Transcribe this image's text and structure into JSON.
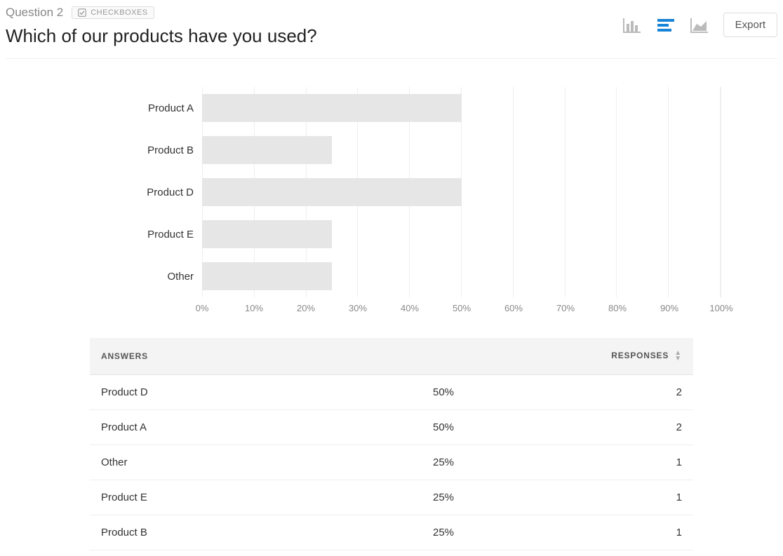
{
  "header": {
    "question_number": "Question 2",
    "type_badge": "CHECKBOXES",
    "title": "Which of our products have you used?",
    "export_label": "Export"
  },
  "chart_data": {
    "type": "bar",
    "orientation": "horizontal",
    "xlabel": "",
    "ylabel": "",
    "xlim": [
      0,
      100
    ],
    "unit": "%",
    "categories": [
      "Product A",
      "Product B",
      "Product D",
      "Product E",
      "Other"
    ],
    "values": [
      50,
      25,
      50,
      25,
      25
    ],
    "ticks": [
      "0%",
      "10%",
      "20%",
      "30%",
      "40%",
      "50%",
      "60%",
      "70%",
      "80%",
      "90%",
      "100%"
    ]
  },
  "table": {
    "headers": {
      "answers": "ANSWERS",
      "responses": "RESPONSES"
    },
    "rows": [
      {
        "answer": "Product D",
        "percent": "50%",
        "count": "2"
      },
      {
        "answer": "Product A",
        "percent": "50%",
        "count": "2"
      },
      {
        "answer": "Other",
        "percent": "25%",
        "count": "1"
      },
      {
        "answer": "Product E",
        "percent": "25%",
        "count": "1"
      },
      {
        "answer": "Product B",
        "percent": "25%",
        "count": "1"
      }
    ]
  }
}
